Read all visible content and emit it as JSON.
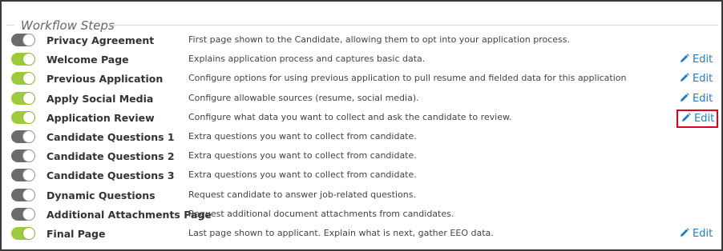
{
  "section_title": "Workflow Steps",
  "colors": {
    "toggle_on": "#9ccc3c",
    "toggle_off": "#6b6b6b",
    "edit_link": "#1a7ed0",
    "highlight_border": "#e0001b"
  },
  "edit_label": "Edit",
  "steps": [
    {
      "name": "Privacy Agreement",
      "description": "First page shown to the Candidate, allowing them to opt into your application process.",
      "enabled": false,
      "editable": false
    },
    {
      "name": "Welcome Page",
      "description": "Explains application process and captures basic data.",
      "enabled": true,
      "editable": true
    },
    {
      "name": "Previous Application",
      "description": "Configure options for using previous application to pull resume and fielded data for this application",
      "enabled": true,
      "editable": true
    },
    {
      "name": "Apply Social Media",
      "description": "Configure allowable sources (resume, social media).",
      "enabled": true,
      "editable": true
    },
    {
      "name": "Application Review",
      "description": "Configure what data you want to collect and ask the candidate to review.",
      "enabled": true,
      "editable": true,
      "highlighted": true
    },
    {
      "name": "Candidate Questions 1",
      "description": "Extra questions you want to collect from candidate.",
      "enabled": false,
      "editable": false
    },
    {
      "name": "Candidate Questions 2",
      "description": "Extra questions you want to collect from candidate.",
      "enabled": false,
      "editable": false
    },
    {
      "name": "Candidate Questions 3",
      "description": "Extra questions you want to collect from candidate.",
      "enabled": false,
      "editable": false
    },
    {
      "name": "Dynamic Questions",
      "description": "Request candidate to answer job-related questions.",
      "enabled": false,
      "editable": false
    },
    {
      "name": "Additional Attachments Page",
      "description": "Request additional document attachments from candidates.",
      "enabled": false,
      "editable": false
    },
    {
      "name": "Final Page",
      "description": "Last page shown to applicant. Explain what is next, gather EEO data.",
      "enabled": true,
      "editable": true
    }
  ]
}
